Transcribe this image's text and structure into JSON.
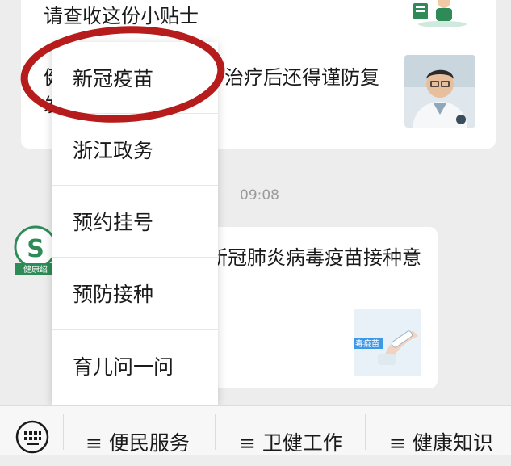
{
  "article_top": {
    "title": "请查收这份小贴士"
  },
  "article_second": {
    "title_line1": "治疗后还得谨防复",
    "title_prefix_line1": "健",
    "title_prefix_line2": "发"
  },
  "timestamp": "09:08",
  "message2": {
    "title": "新冠肺炎病毒疫苗接种意",
    "avatar_letter": "S",
    "avatar_caption": "健康绍"
  },
  "thumb_labels": {
    "vaccine": "毒疫苗"
  },
  "popup_menu": {
    "items": [
      {
        "label": "新冠疫苗"
      },
      {
        "label": "浙江政务"
      },
      {
        "label": "预约挂号"
      },
      {
        "label": "预防接种"
      },
      {
        "label": "育儿问一问"
      }
    ],
    "highlight_color": "#b71c1c"
  },
  "bottom_bar": {
    "items": [
      {
        "label": "≡ 便民服务"
      },
      {
        "label": "≡ 卫健工作"
      },
      {
        "label": "≡ 健康知识"
      }
    ]
  },
  "colors": {
    "accent_green": "#2e8b57",
    "background": "#ededed"
  }
}
